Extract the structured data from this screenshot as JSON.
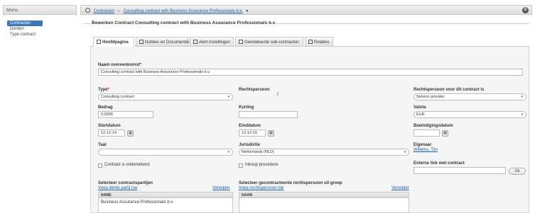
{
  "sidebar": {
    "header": "Menu",
    "items": [
      {
        "label": "Contracten",
        "active": true
      },
      {
        "label": "Derden",
        "active": false
      },
      {
        "label": "Type contract",
        "active": false
      }
    ]
  },
  "topbar": {
    "crumb1": "Contracten",
    "separator": "»",
    "crumb2": "Consulting contract with Business Assurance Professionals b.v.",
    "caret": "▼",
    "gear_icon": "gear-icon"
  },
  "section_title": "Bewerken Contract Consulting contract with Business Assurance Professionals b.v.",
  "tabs": [
    {
      "label": "Hoofdpagina",
      "active": true
    },
    {
      "label": "Notities en Documenten",
      "active": false
    },
    {
      "label": "Alert instellingen",
      "active": false
    },
    {
      "label": "Gerelateerde sub-contracten:",
      "active": false
    },
    {
      "label": "Relaties",
      "active": false
    }
  ],
  "form": {
    "naam": {
      "label": "Naam overeenkomst",
      "required": "*",
      "value": "Consulting contract with Business Assurance Professionals b.v."
    },
    "type": {
      "label": "Type",
      "required": "*",
      "value": "Consulting contract"
    },
    "rechtspersoon": {
      "label": "Rechtspersoon"
    },
    "rechtspersoon_contract": {
      "label": "Rechtspersoon voor dit contract is",
      "value": "Service provider"
    },
    "bedrag": {
      "label": "Bedrag",
      "value": "0,0000"
    },
    "korting": {
      "label": "Korting",
      "value": ""
    },
    "valuta": {
      "label": "Valuta",
      "value": "EUR"
    },
    "startdatum": {
      "label": "Startdatum",
      "value": "12-12-14"
    },
    "einddatum": {
      "label": "Einddatum",
      "value": "12-12-15"
    },
    "beeindigingsdatum": {
      "label": "Beeindigingsdatum",
      "value": ""
    },
    "taal": {
      "label": "Taal",
      "value": ""
    },
    "jurisdictie": {
      "label": "Jurisdictie",
      "value": "Netherlands (NLD)"
    },
    "eigenaar": {
      "label": "Eigenaar",
      "value": "Willems, Tim"
    },
    "ondertekend": {
      "label": "Contract is ondertekend"
    },
    "inkoop": {
      "label": "Inkoop procedure"
    },
    "externe_link": {
      "label": "Externe link met contract",
      "value": "",
      "button": "Ok"
    },
    "partijen": {
      "label": "Selecteer contractspartijen",
      "add": "Voeg derde partij toe",
      "remove": "Verwijder",
      "column": "NAME",
      "rows": [
        "Business Assurance Professionals b.v."
      ]
    },
    "gecontracteerde": {
      "label": "Selecteer gecontracteerde rechtspersoon uit groep",
      "add": "Voeg rechtspersoon toe",
      "remove": "Verwijder",
      "column": "NAAM"
    }
  }
}
